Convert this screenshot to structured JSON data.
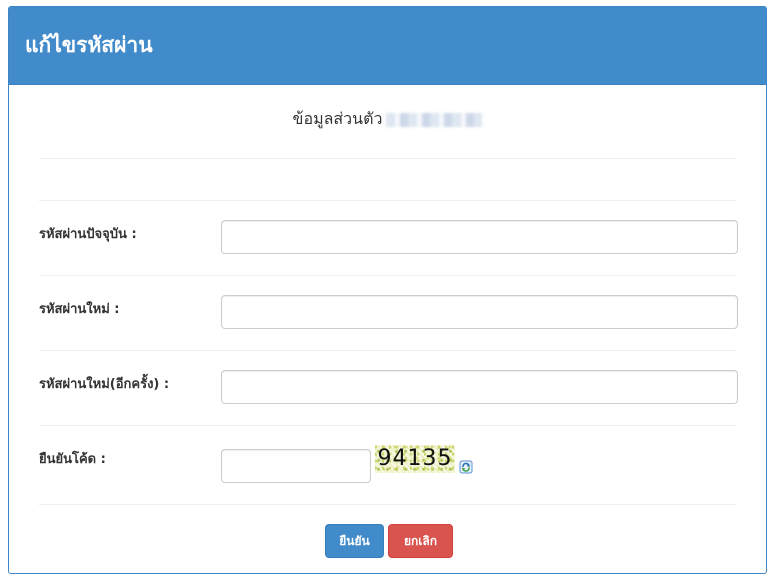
{
  "header": {
    "title": "แก้ไขรหัสผ่าน"
  },
  "profile": {
    "label": "ข้อมูลส่วนตัว"
  },
  "form": {
    "current_password_label": "รหัสผ่านปัจจุบัน :",
    "new_password_label": "รหัสผ่านใหม่ :",
    "confirm_password_label": "รหัสผ่านใหม่(อีกครั้ง) :",
    "confirm_code_label": "ยืนยันโค้ด :",
    "captcha_text": "94135"
  },
  "buttons": {
    "submit_label": "ยืนยัน",
    "cancel_label": "ยกเลิก"
  },
  "colors": {
    "header_bg": "#428bca",
    "primary_button": "#428bca",
    "danger_button": "#d9534f"
  },
  "icons": {
    "refresh": "refresh-icon"
  }
}
